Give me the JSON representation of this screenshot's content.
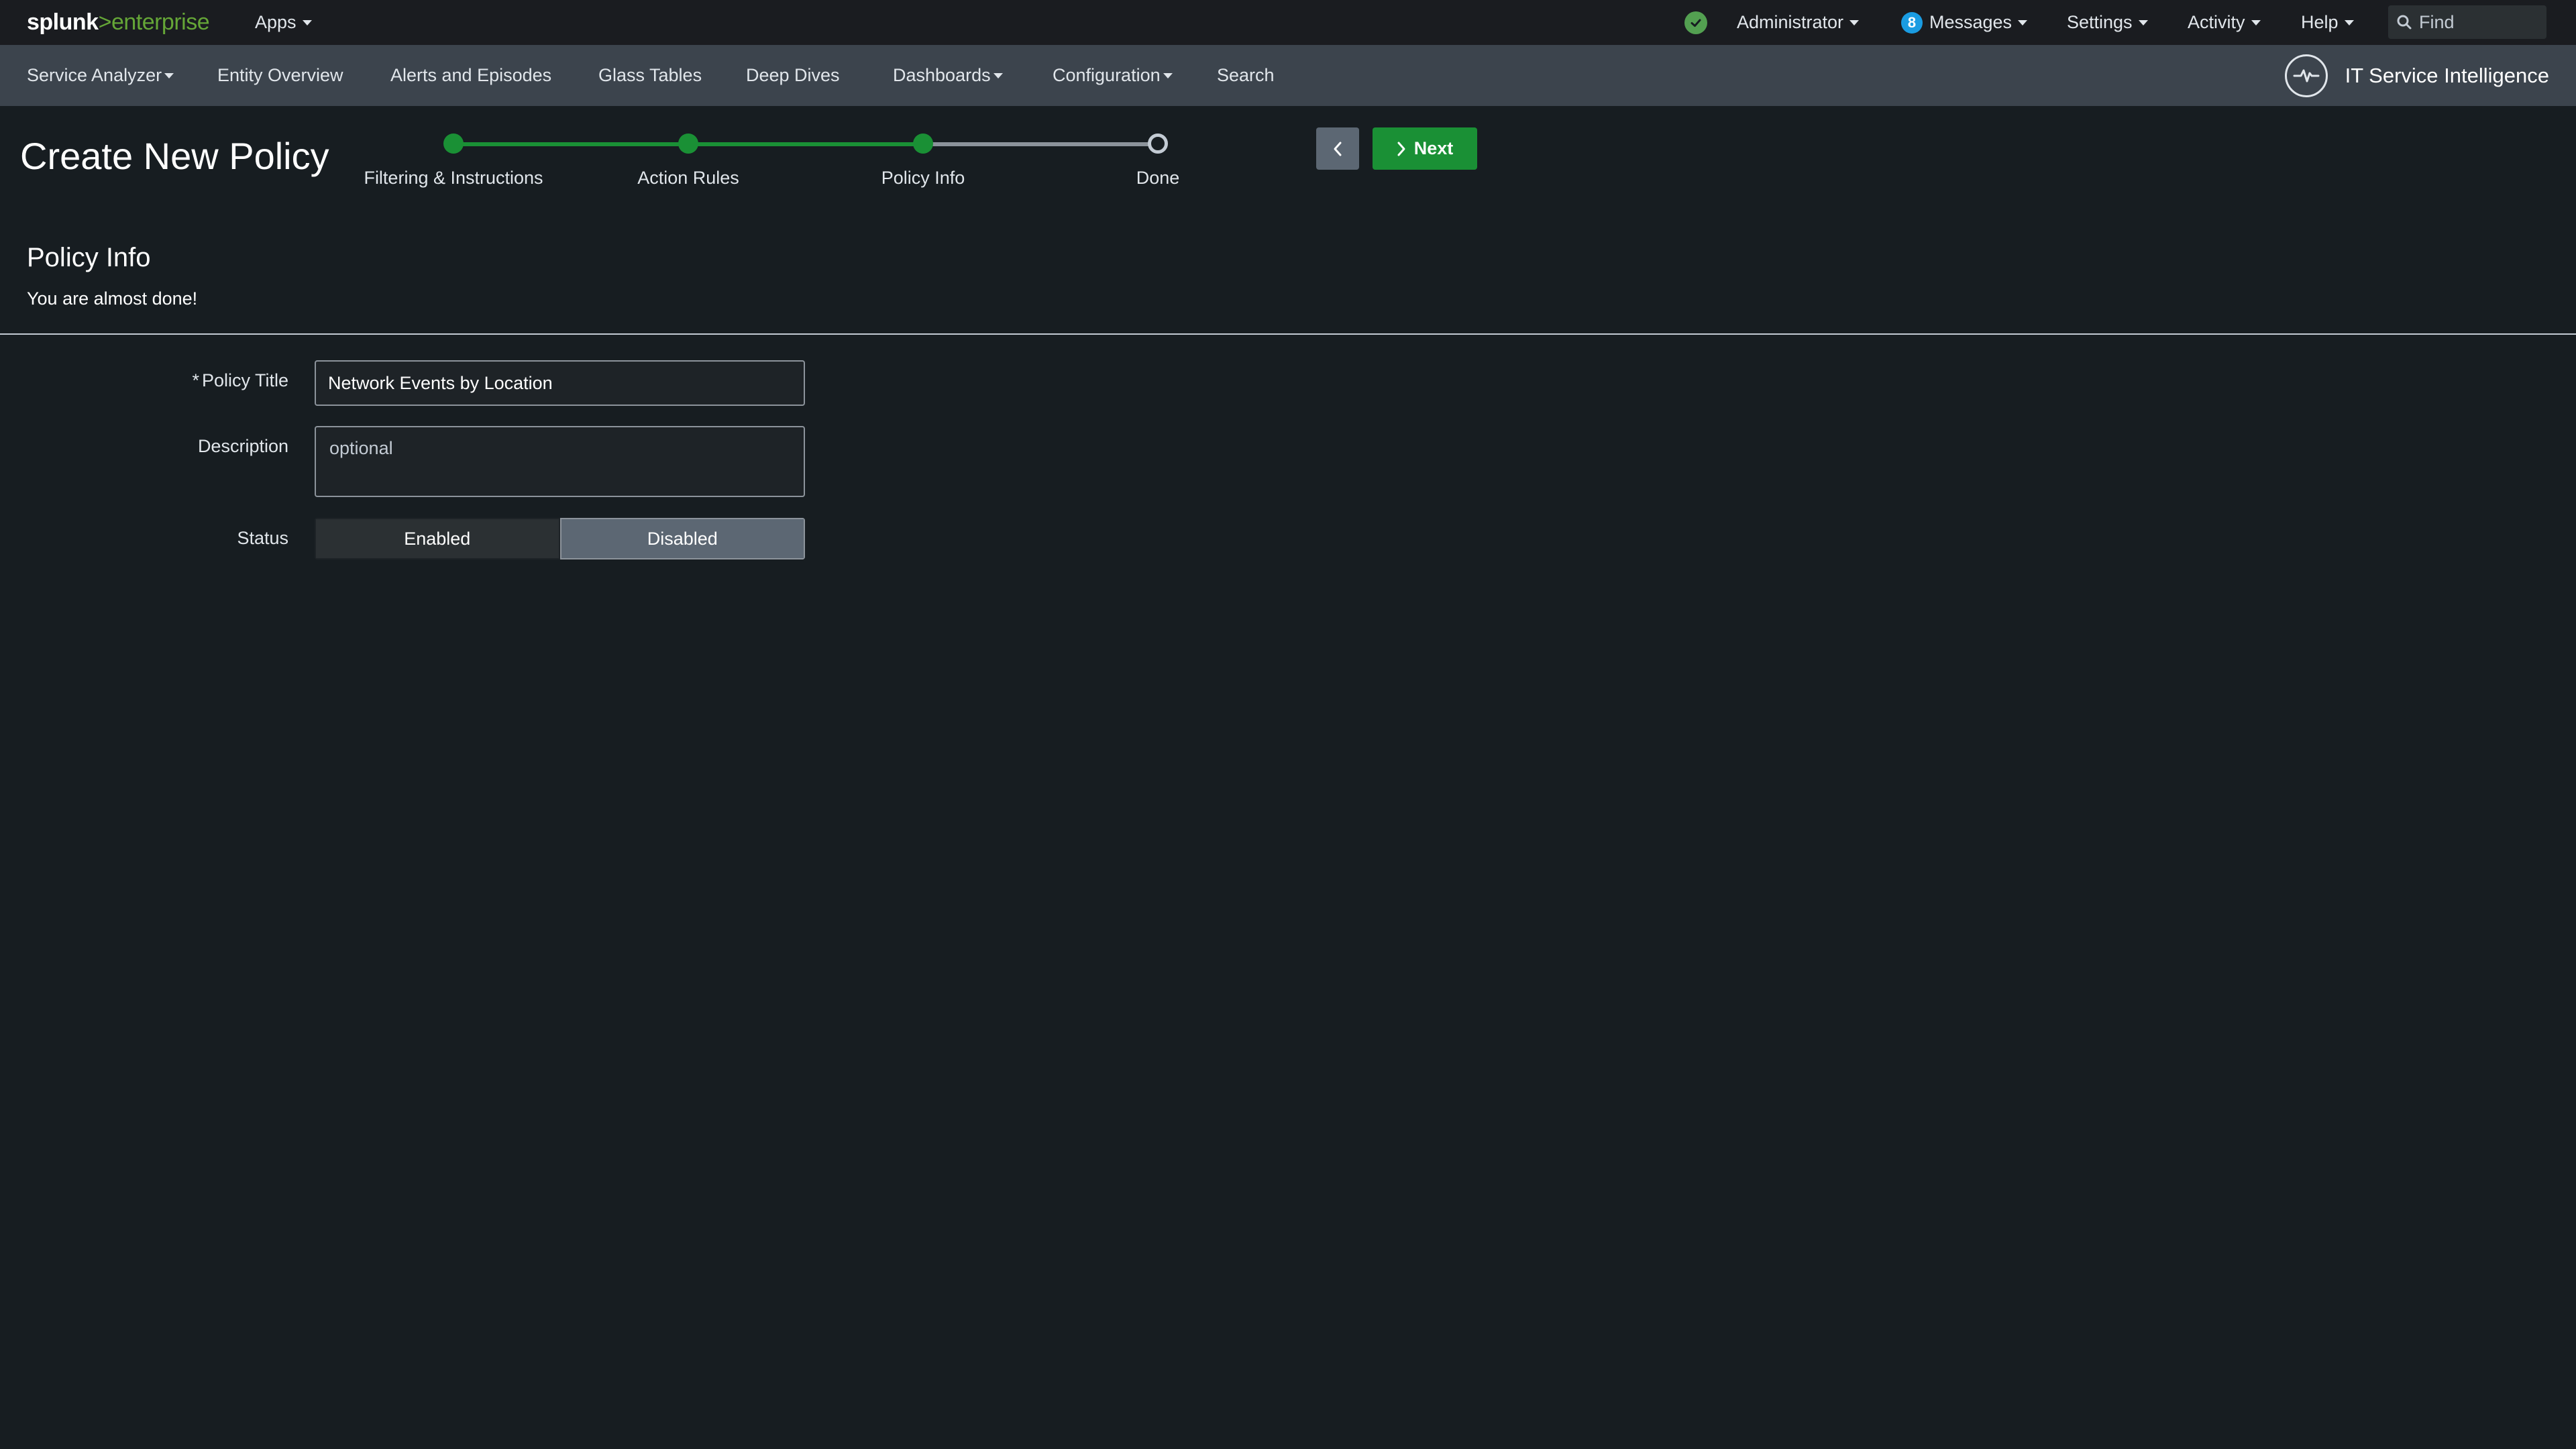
{
  "topbar": {
    "logo_prefix": "splunk",
    "logo_gt": ">",
    "logo_suffix": "enterprise",
    "apps_label": "Apps",
    "health_icon": "check-circle-icon",
    "admin_label": "Administrator",
    "messages_count": "8",
    "messages_label": "Messages",
    "settings_label": "Settings",
    "activity_label": "Activity",
    "help_label": "Help",
    "find_placeholder": "Find"
  },
  "appnav": {
    "items": [
      {
        "label": "Service Analyzer",
        "dropdown": true
      },
      {
        "label": "Entity Overview",
        "dropdown": false
      },
      {
        "label": "Alerts and Episodes",
        "dropdown": false
      },
      {
        "label": "Glass Tables",
        "dropdown": false
      },
      {
        "label": "Deep Dives",
        "dropdown": false
      },
      {
        "label": "Dashboards",
        "dropdown": true
      },
      {
        "label": "Configuration",
        "dropdown": true
      },
      {
        "label": "Search",
        "dropdown": false
      }
    ],
    "app_title": "IT Service Intelligence",
    "app_icon": "pulse-icon"
  },
  "page": {
    "title": "Create New Policy",
    "steps": [
      {
        "label": "Filtering & Instructions",
        "state": "done"
      },
      {
        "label": "Action Rules",
        "state": "done"
      },
      {
        "label": "Policy Info",
        "state": "done"
      },
      {
        "label": "Done",
        "state": "todo"
      }
    ],
    "prev_icon": "chevron-left-icon",
    "next_label": "Next"
  },
  "section": {
    "title": "Policy Info",
    "subtitle": "You are almost done!"
  },
  "form": {
    "policy_title_label": "Policy Title",
    "policy_title_required": "*",
    "policy_title_value": "Network Events by Location",
    "description_label": "Description",
    "description_placeholder": "optional",
    "status_label": "Status",
    "status_options": [
      "Enabled",
      "Disabled"
    ],
    "status_selected": "Disabled"
  },
  "colors": {
    "accent_green": "#1a9035",
    "brand_green": "#65a637",
    "badge_blue": "#1a9ce2",
    "background": "#171d21"
  }
}
